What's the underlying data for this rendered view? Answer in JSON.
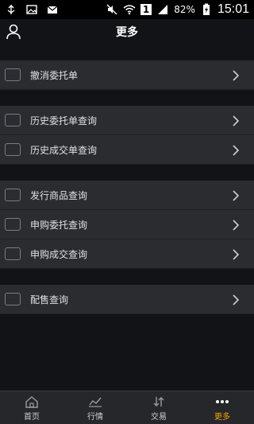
{
  "status_bar": {
    "battery": "82%",
    "sim_badge": "1",
    "time": "15:01"
  },
  "header": {
    "title": "更多"
  },
  "menu": {
    "groups": [
      {
        "items": [
          {
            "label": "撤消委托单"
          }
        ]
      },
      {
        "items": [
          {
            "label": "历史委托单查询"
          },
          {
            "label": "历史成交单查询"
          }
        ]
      },
      {
        "items": [
          {
            "label": "发行商品查询"
          },
          {
            "label": "申购委托查询"
          },
          {
            "label": "申购成交查询"
          }
        ]
      },
      {
        "items": [
          {
            "label": "配售查询"
          }
        ]
      }
    ]
  },
  "bottom_nav": {
    "items": [
      {
        "label": "首页",
        "icon": "home-icon"
      },
      {
        "label": "行情",
        "icon": "chart-icon"
      },
      {
        "label": "交易",
        "icon": "trade-icon"
      },
      {
        "label": "更多",
        "icon": "more-icon"
      }
    ],
    "active": "更多",
    "active_color": "#f0a500"
  }
}
